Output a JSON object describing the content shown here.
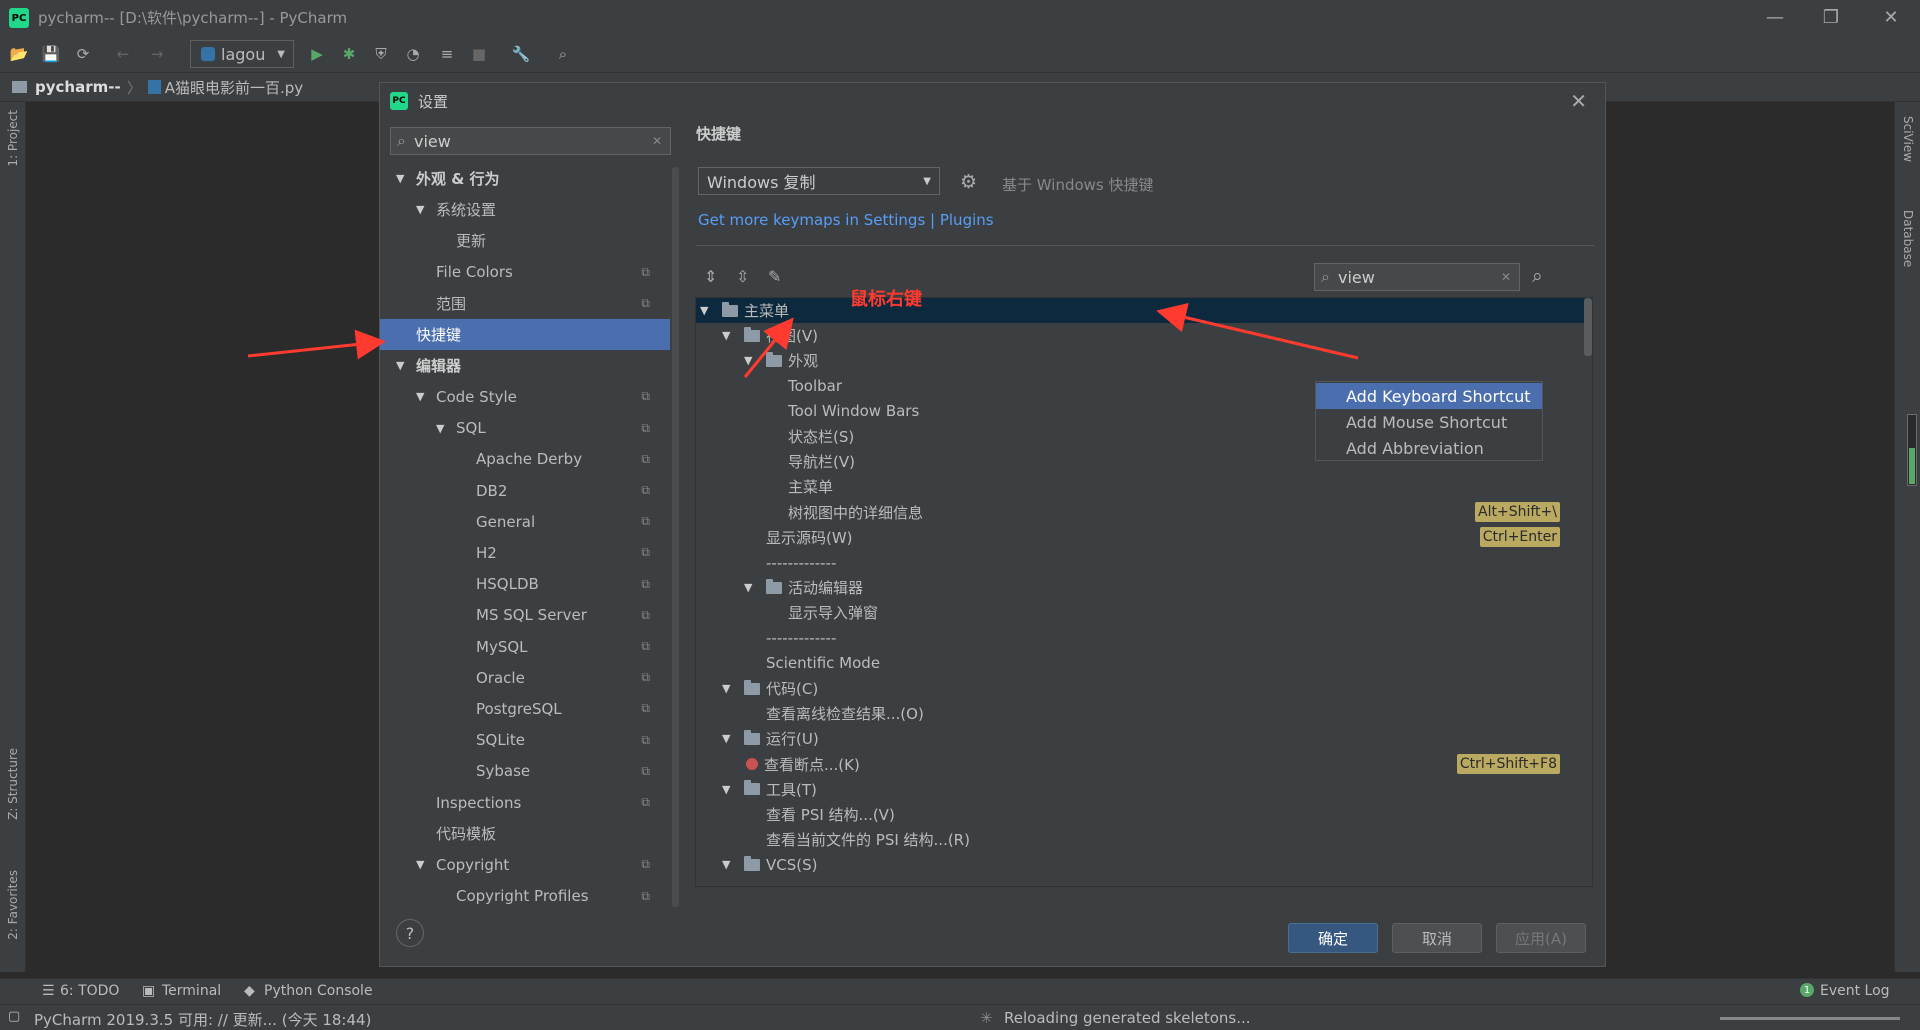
{
  "window": {
    "title": "pycharm-- [D:\\软件\\pycharm--] - PyCharm"
  },
  "toolbar": {
    "run_config": "lagou"
  },
  "navbar": {
    "project": "pycharm--",
    "file": "A猫眼电影前一百.py"
  },
  "left_strip": {
    "project_tab": "1: Project",
    "structure_tab": "Z: Structure",
    "favorites_tab": "2: Favorites"
  },
  "right_strip": {
    "sciview_tab": "SciView",
    "database_tab": "Database"
  },
  "dialog": {
    "title": "设置",
    "search": {
      "value": "view"
    },
    "tree": [
      {
        "label": "外观 & 行为",
        "level": 0,
        "expanded": true,
        "bold": true
      },
      {
        "label": "系统设置",
        "level": 1,
        "expanded": true
      },
      {
        "label": "更新",
        "level": 2
      },
      {
        "label": "File Colors",
        "level": 1,
        "copy": true
      },
      {
        "label": "范围",
        "level": 1,
        "copy": true
      },
      {
        "label": "快捷键",
        "level": 0,
        "selected": true
      },
      {
        "label": "编辑器",
        "level": 0,
        "expanded": true,
        "bold": true
      },
      {
        "label": "Code Style",
        "level": 1,
        "expanded": true,
        "copy": true
      },
      {
        "label": "SQL",
        "level": 2,
        "expanded": true,
        "copy": true
      },
      {
        "label": "Apache Derby",
        "level": 3,
        "copy": true
      },
      {
        "label": "DB2",
        "level": 3,
        "copy": true
      },
      {
        "label": "General",
        "level": 3,
        "copy": true
      },
      {
        "label": "H2",
        "level": 3,
        "copy": true
      },
      {
        "label": "HSQLDB",
        "level": 3,
        "copy": true
      },
      {
        "label": "MS SQL Server",
        "level": 3,
        "copy": true
      },
      {
        "label": "MySQL",
        "level": 3,
        "copy": true
      },
      {
        "label": "Oracle",
        "level": 3,
        "copy": true
      },
      {
        "label": "PostgreSQL",
        "level": 3,
        "copy": true
      },
      {
        "label": "SQLite",
        "level": 3,
        "copy": true
      },
      {
        "label": "Sybase",
        "level": 3,
        "copy": true
      },
      {
        "label": "Inspections",
        "level": 1,
        "copy": true
      },
      {
        "label": "代码模板",
        "level": 1
      },
      {
        "label": "Copyright",
        "level": 1,
        "expanded": true,
        "copy": true
      },
      {
        "label": "Copyright Profiles",
        "level": 2,
        "copy": true
      }
    ],
    "keymap": {
      "heading": "快捷键",
      "selected": "Windows 复制",
      "based_on": "基于 Windows 快捷键",
      "link": "Get more keymaps in Settings | Plugins",
      "filter": "view"
    },
    "keymap_tree": [
      {
        "label": "主菜单",
        "indent": 0,
        "folder": true,
        "expanded": true,
        "selected": true
      },
      {
        "label": "视图(V)",
        "indent": 1,
        "folder": true,
        "expanded": true
      },
      {
        "label": "外观",
        "indent": 2,
        "folder": true,
        "expanded": true
      },
      {
        "label": "Toolbar",
        "indent": 3
      },
      {
        "label": "Tool Window Bars",
        "indent": 3
      },
      {
        "label": "状态栏(S)",
        "indent": 3
      },
      {
        "label": "导航栏(V)",
        "indent": 3
      },
      {
        "label": "主菜单",
        "indent": 3
      },
      {
        "label": "树视图中的详细信息",
        "indent": 3,
        "shortcut": "Alt+Shift+\\"
      },
      {
        "label": "显示源码(W)",
        "indent": 2,
        "shortcut": "Ctrl+Enter"
      },
      {
        "label": "-------------",
        "indent": 2
      },
      {
        "label": "活动编辑器",
        "indent": 2,
        "folder": true,
        "expanded": true
      },
      {
        "label": "显示导入弹窗",
        "indent": 3
      },
      {
        "label": "-------------",
        "indent": 2
      },
      {
        "label": "Scientific Mode",
        "indent": 2
      },
      {
        "label": "代码(C)",
        "indent": 1,
        "folder": true,
        "expanded": true
      },
      {
        "label": "查看离线检查结果...(O)",
        "indent": 2
      },
      {
        "label": "运行(U)",
        "indent": 1,
        "folder": true,
        "expanded": true
      },
      {
        "label": "查看断点...(K)",
        "indent": 2,
        "shortcut": "Ctrl+Shift+F8",
        "breakpoint": true
      },
      {
        "label": "工具(T)",
        "indent": 1,
        "folder": true,
        "expanded": true
      },
      {
        "label": "查看 PSI 结构...(V)",
        "indent": 2
      },
      {
        "label": "查看当前文件的 PSI 结构...(R)",
        "indent": 2
      },
      {
        "label": "VCS(S)",
        "indent": 1,
        "folder": true,
        "expanded": true
      }
    ],
    "context_menu": [
      "Add Keyboard Shortcut",
      "Add Mouse Shortcut",
      "Add Abbreviation"
    ],
    "annotation": "鼠标右键",
    "buttons": {
      "ok": "确定",
      "cancel": "取消",
      "apply": "应用(A)"
    },
    "help": "?"
  },
  "bottom_tools": {
    "todo": "6: TODO",
    "terminal": "Terminal",
    "python_console": "Python Console",
    "event_log": "Event Log",
    "event_count": "1"
  },
  "status": {
    "left": "PyCharm 2019.3.5 可用: // 更新... (今天 18:44)",
    "center": "Reloading generated skeletons..."
  },
  "colors": {
    "selection": "#4b6eaf",
    "link": "#589df6",
    "annotation": "#ff3b30",
    "shortcut_bg": "#b9a961"
  }
}
